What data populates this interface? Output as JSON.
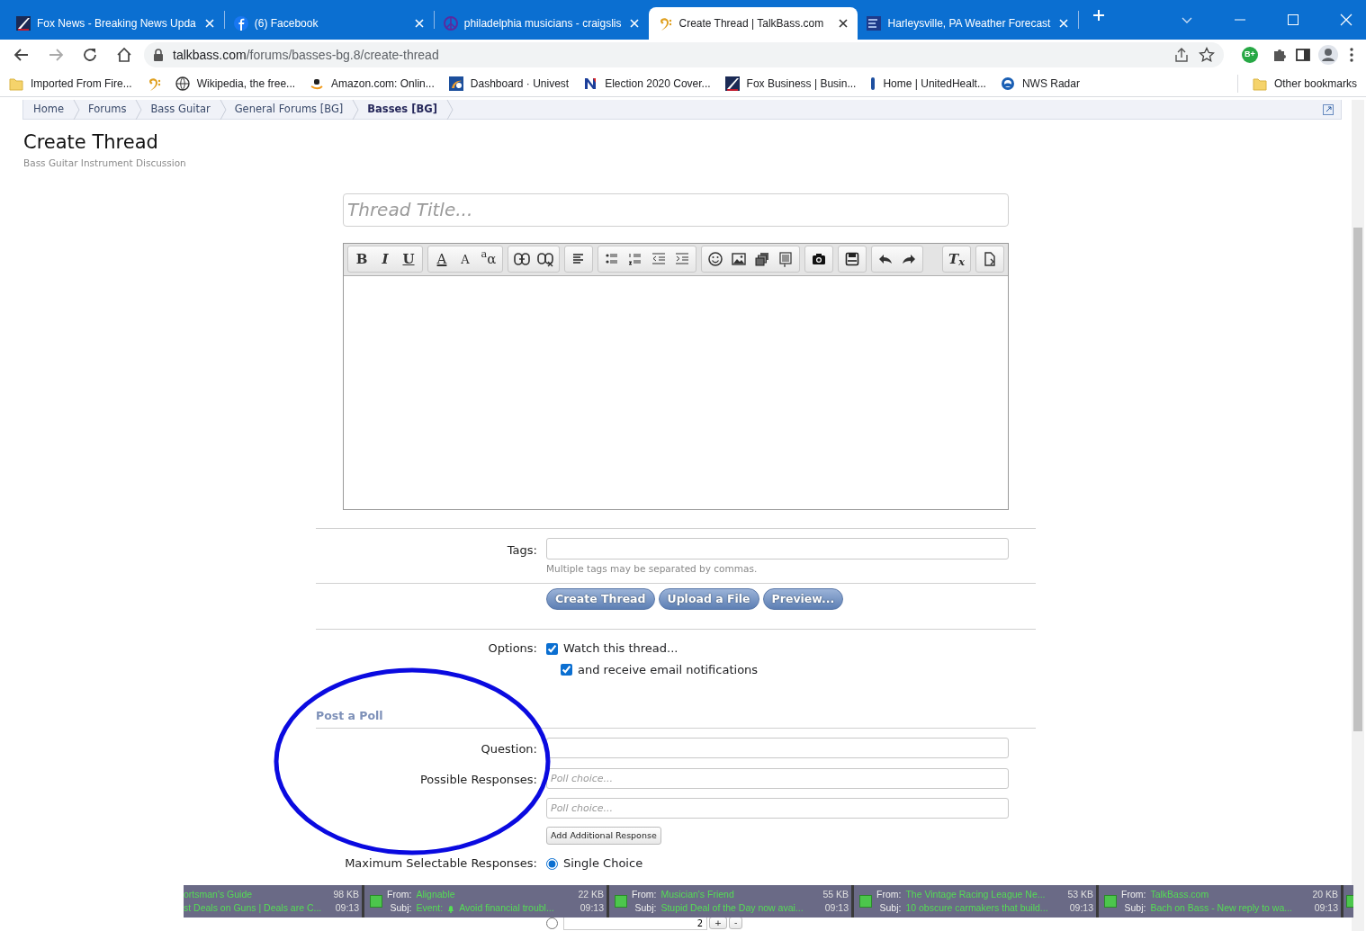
{
  "browser": {
    "tabs": [
      {
        "title": "Fox News - Breaking News Upda",
        "selected": false
      },
      {
        "title": "(6) Facebook",
        "selected": false
      },
      {
        "title": "philadelphia musicians - craigslis",
        "selected": false
      },
      {
        "title": "Create Thread | TalkBass.com",
        "selected": true
      },
      {
        "title": "Harleysville, PA Weather Forecast",
        "selected": false
      }
    ],
    "url_host": "talkbass.com",
    "url_path": "/forums/basses-bg.8/create-thread",
    "extension_badge": "B+",
    "bookmarks": [
      {
        "kind": "link",
        "label": "Imported From Fire..."
      },
      {
        "kind": "icon"
      },
      {
        "kind": "link",
        "label": "Wikipedia, the free..."
      },
      {
        "kind": "link",
        "label": "Amazon.com: Onlin..."
      },
      {
        "kind": "link",
        "label": "Dashboard · Univest"
      },
      {
        "kind": "link",
        "label": "Election 2020 Cover..."
      },
      {
        "kind": "link",
        "label": "Fox Business | Busin..."
      },
      {
        "kind": "link",
        "label": "Home | UnitedHealt..."
      },
      {
        "kind": "link",
        "label": "NWS Radar"
      }
    ],
    "other_bookmarks": "Other bookmarks"
  },
  "breadcrumb": [
    {
      "label": "Home",
      "selected": false
    },
    {
      "label": "Forums",
      "selected": false
    },
    {
      "label": "Bass Guitar",
      "selected": false
    },
    {
      "label": "General Forums [BG]",
      "selected": false
    },
    {
      "label": "Basses [BG]",
      "selected": true
    }
  ],
  "page": {
    "title": "Create Thread",
    "subtitle": "Bass Guitar Instrument Discussion"
  },
  "form": {
    "title_placeholder": "Thread Title...",
    "toolbar": [
      [
        {
          "kind": "bold",
          "label": "B"
        },
        {
          "kind": "italic",
          "label": "I"
        },
        {
          "kind": "underline",
          "label": "U"
        }
      ],
      [
        {
          "kind": "color",
          "label": "A"
        },
        {
          "kind": "size",
          "label": "A"
        },
        {
          "kind": "font",
          "label": "$^{a}$α"
        }
      ],
      [
        {
          "kind": "link"
        },
        {
          "kind": "unlink"
        }
      ],
      [
        {
          "kind": "align"
        }
      ],
      [
        {
          "kind": "bullets"
        },
        {
          "kind": "numbers"
        },
        {
          "kind": "outdent"
        },
        {
          "kind": "indent"
        }
      ],
      [
        {
          "kind": "smilie"
        },
        {
          "kind": "image"
        },
        {
          "kind": "media"
        },
        {
          "kind": "quote"
        }
      ],
      [
        {
          "kind": "camera"
        }
      ],
      [
        {
          "kind": "save"
        }
      ],
      [
        {
          "kind": "undo"
        },
        {
          "kind": "redo"
        }
      ]
    ],
    "toolbar_right": [
      [
        {
          "kind": "remove",
          "label": "T$_{x}$"
        }
      ],
      [
        {
          "kind": "source"
        }
      ]
    ],
    "tags_label": "Tags:",
    "tags_hint": "Multiple tags may be separated by commas.",
    "buttons": [
      "Create Thread",
      "Upload a File",
      "Preview..."
    ],
    "options_label": "Options:",
    "options": [
      {
        "label": "Watch this thread...",
        "checked": true,
        "children": [
          {
            "label": "and receive email notifications",
            "checked": true
          }
        ]
      }
    ],
    "poll": {
      "heading": "Post a Poll",
      "question_label": "Question:",
      "responses_label": "Possible Responses:",
      "responses": [
        {
          "placeholder": "Poll choice..."
        },
        {
          "placeholder": "Poll choice..."
        }
      ],
      "add_button": "Add Additional Response",
      "max_label": "Maximum Selectable Responses:",
      "max_options": [
        {
          "kind": "radio",
          "label": "Single Choice",
          "selected": true
        },
        {
          "kind": "number",
          "value": "2",
          "selected": false,
          "buttons": [
            "+",
            "-"
          ]
        }
      ]
    }
  },
  "notifications": [
    {
      "from": "ortsman's Guide",
      "subject": "st Deals on Guns | Deals are C...",
      "size": "98 KB",
      "time": "09:13"
    },
    {
      "from_label": "From:",
      "subj_label": "Subj:",
      "from": "Alignable",
      "subject_prefix": "Event:",
      "subject": "Avoid financial troubl...",
      "size": "22 KB",
      "time": "09:13"
    },
    {
      "from_label": "From:",
      "subj_label": "Subj:",
      "from": "Musician's Friend",
      "subject": "Stupid Deal of the Day now avai...",
      "size": "55 KB",
      "time": "09:13"
    },
    {
      "from_label": "From:",
      "subj_label": "Subj:",
      "from": "The Vintage Racing League Ne...",
      "subject": "10 obscure carmakers that build...",
      "size": "53 KB",
      "time": "09:13"
    },
    {
      "from_label": "From:",
      "subj_label": "Subj:",
      "from": "TalkBass.com",
      "subject": "Bach on Bass - New reply to wa...",
      "size": "20 KB",
      "time": "09:13"
    }
  ]
}
